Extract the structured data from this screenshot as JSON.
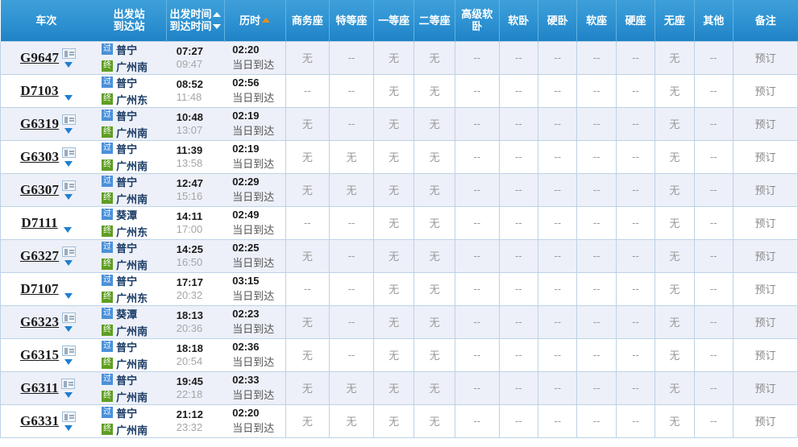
{
  "table": {
    "headers": {
      "train_no": "车次",
      "station_from": "出发站",
      "station_to": "到达站",
      "time_depart": "出发时间",
      "time_arrive": "到达时间",
      "duration": "历时",
      "business": "商务座",
      "special": "特等座",
      "first": "一等座",
      "second": "二等座",
      "premium_soft_sleeper": "高级软卧",
      "soft_sleeper": "软卧",
      "hard_sleeper": "硬卧",
      "soft_seat": "软座",
      "hard_seat": "硬座",
      "no_seat": "无座",
      "other": "其他",
      "remark": "备注"
    },
    "sort": {
      "depart_icon": "caret-up-icon",
      "arrive_icon": "caret-down-icon",
      "duration_icon": "caret-up-icon",
      "active_color": "#f08c1b",
      "inactive_color": "#ffffff"
    },
    "badges": {
      "pass": "过",
      "end": "终"
    },
    "rows": [
      {
        "train_no": "G9647",
        "has_idcard": true,
        "from": "普宁",
        "to": "广州南",
        "depart": "07:27",
        "arrive": "09:47",
        "duration": "02:20",
        "arrive_day": "当日到达",
        "seats": [
          "无",
          "--",
          "无",
          "无",
          "--",
          "--",
          "--",
          "--",
          "--",
          "无",
          "--"
        ],
        "remark": "预订"
      },
      {
        "train_no": "D7103",
        "has_idcard": false,
        "from": "普宁",
        "to": "广州东",
        "depart": "08:52",
        "arrive": "11:48",
        "duration": "02:56",
        "arrive_day": "当日到达",
        "seats": [
          "--",
          "--",
          "无",
          "无",
          "--",
          "--",
          "--",
          "--",
          "--",
          "无",
          "--"
        ],
        "remark": "预订"
      },
      {
        "train_no": "G6319",
        "has_idcard": true,
        "from": "普宁",
        "to": "广州南",
        "depart": "10:48",
        "arrive": "13:07",
        "duration": "02:19",
        "arrive_day": "当日到达",
        "seats": [
          "无",
          "--",
          "无",
          "无",
          "--",
          "--",
          "--",
          "--",
          "--",
          "无",
          "--"
        ],
        "remark": "预订"
      },
      {
        "train_no": "G6303",
        "has_idcard": true,
        "from": "普宁",
        "to": "广州南",
        "depart": "11:39",
        "arrive": "13:58",
        "duration": "02:19",
        "arrive_day": "当日到达",
        "seats": [
          "无",
          "无",
          "无",
          "无",
          "--",
          "--",
          "--",
          "--",
          "--",
          "无",
          "--"
        ],
        "remark": "预订"
      },
      {
        "train_no": "G6307",
        "has_idcard": true,
        "from": "普宁",
        "to": "广州南",
        "depart": "12:47",
        "arrive": "15:16",
        "duration": "02:29",
        "arrive_day": "当日到达",
        "seats": [
          "无",
          "无",
          "无",
          "无",
          "--",
          "--",
          "--",
          "--",
          "--",
          "无",
          "--"
        ],
        "remark": "预订"
      },
      {
        "train_no": "D7111",
        "has_idcard": false,
        "from": "葵潭",
        "to": "广州东",
        "depart": "14:11",
        "arrive": "17:00",
        "duration": "02:49",
        "arrive_day": "当日到达",
        "seats": [
          "--",
          "--",
          "无",
          "无",
          "--",
          "--",
          "--",
          "--",
          "--",
          "无",
          "--"
        ],
        "remark": "预订"
      },
      {
        "train_no": "G6327",
        "has_idcard": true,
        "from": "普宁",
        "to": "广州南",
        "depart": "14:25",
        "arrive": "16:50",
        "duration": "02:25",
        "arrive_day": "当日到达",
        "seats": [
          "无",
          "--",
          "无",
          "无",
          "--",
          "--",
          "--",
          "--",
          "--",
          "无",
          "--"
        ],
        "remark": "预订"
      },
      {
        "train_no": "D7107",
        "has_idcard": false,
        "from": "普宁",
        "to": "广州东",
        "depart": "17:17",
        "arrive": "20:32",
        "duration": "03:15",
        "arrive_day": "当日到达",
        "seats": [
          "--",
          "--",
          "无",
          "无",
          "--",
          "--",
          "--",
          "--",
          "--",
          "无",
          "--"
        ],
        "remark": "预订"
      },
      {
        "train_no": "G6323",
        "has_idcard": true,
        "from": "葵潭",
        "to": "广州南",
        "depart": "18:13",
        "arrive": "20:36",
        "duration": "02:23",
        "arrive_day": "当日到达",
        "seats": [
          "无",
          "--",
          "无",
          "无",
          "--",
          "--",
          "--",
          "--",
          "--",
          "无",
          "--"
        ],
        "remark": "预订"
      },
      {
        "train_no": "G6315",
        "has_idcard": true,
        "from": "普宁",
        "to": "广州南",
        "depart": "18:18",
        "arrive": "20:54",
        "duration": "02:36",
        "arrive_day": "当日到达",
        "seats": [
          "无",
          "--",
          "无",
          "无",
          "--",
          "--",
          "--",
          "--",
          "--",
          "无",
          "--"
        ],
        "remark": "预订"
      },
      {
        "train_no": "G6311",
        "has_idcard": true,
        "from": "普宁",
        "to": "广州南",
        "depart": "19:45",
        "arrive": "22:18",
        "duration": "02:33",
        "arrive_day": "当日到达",
        "seats": [
          "无",
          "无",
          "无",
          "无",
          "--",
          "--",
          "--",
          "--",
          "--",
          "无",
          "--"
        ],
        "remark": "预订"
      },
      {
        "train_no": "G6331",
        "has_idcard": true,
        "from": "普宁",
        "to": "广州南",
        "depart": "21:12",
        "arrive": "23:32",
        "duration": "02:20",
        "arrive_day": "当日到达",
        "seats": [
          "无",
          "无",
          "无",
          "无",
          "--",
          "--",
          "--",
          "--",
          "--",
          "无",
          "--"
        ],
        "remark": "预订"
      }
    ]
  }
}
